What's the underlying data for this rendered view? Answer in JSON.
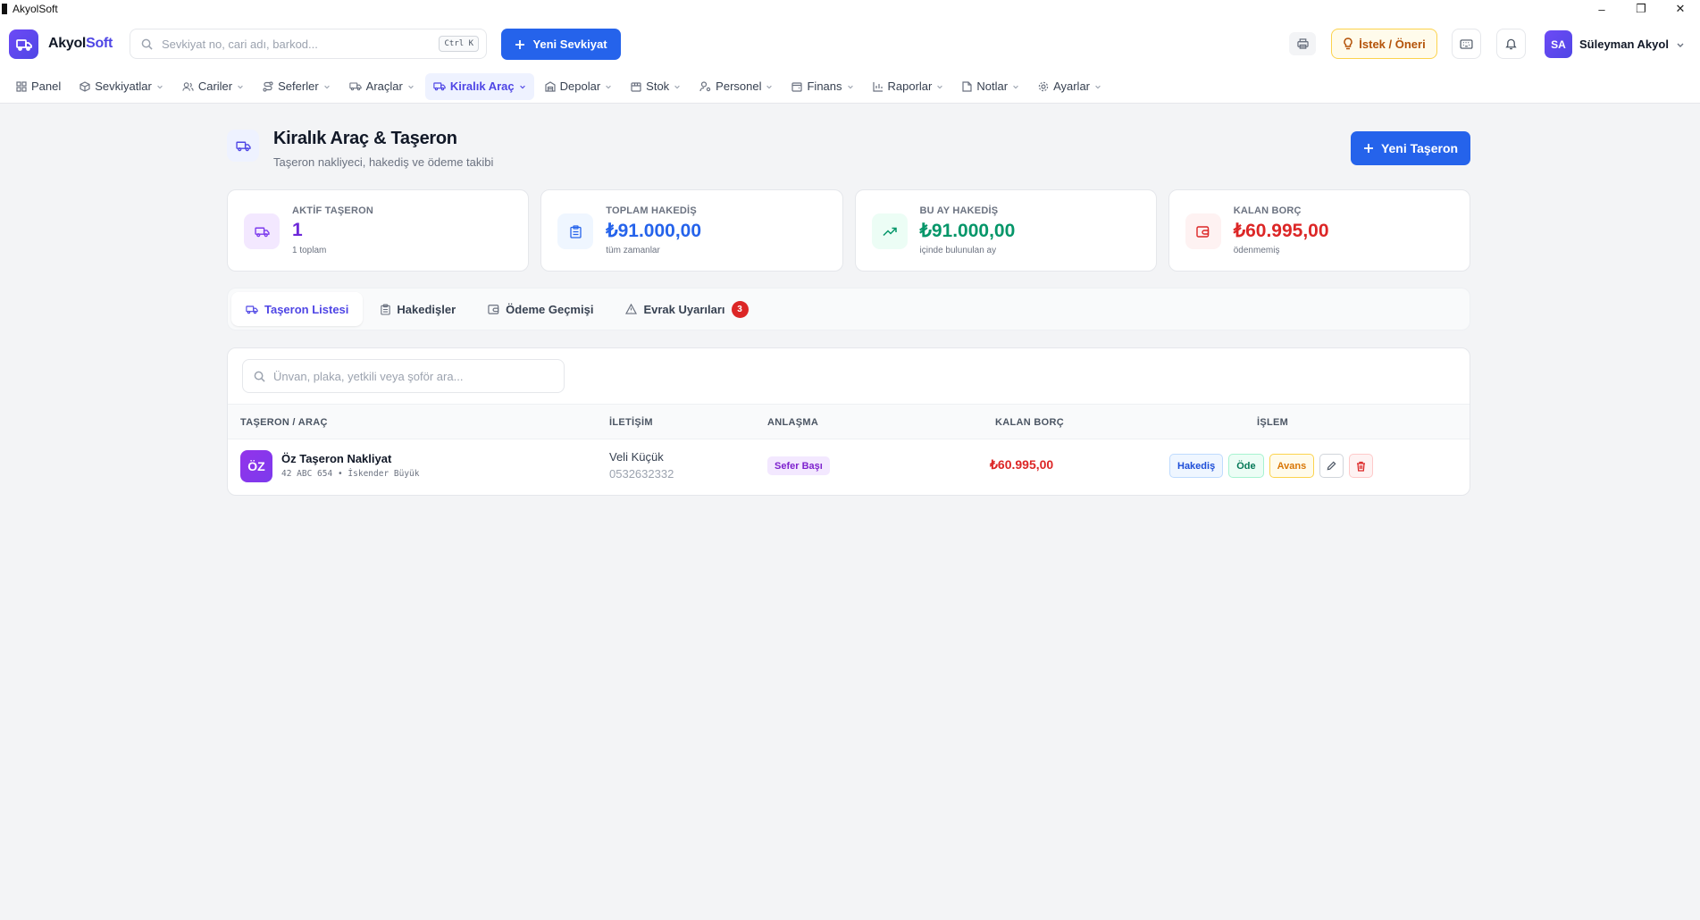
{
  "window": {
    "title": "AkyolSoft",
    "controls": [
      "–",
      "❐",
      "✕"
    ]
  },
  "header": {
    "logo_main": "Akyol",
    "logo_accent": "Soft",
    "search_placeholder": "Sevkiyat no, cari adı, barkod...",
    "search_shortcut": "Ctrl K",
    "new_shipment_label": "Yeni Sevkiyat",
    "suggestion_label": "İstek / Öneri",
    "user_initials": "SA",
    "user_name": "Süleyman Akyol"
  },
  "nav": {
    "items": [
      {
        "label": "Panel",
        "icon": "grid-icon"
      },
      {
        "label": "Sevkiyatlar",
        "icon": "box-icon"
      },
      {
        "label": "Cariler",
        "icon": "users-icon"
      },
      {
        "label": "Seferler",
        "icon": "route-icon"
      },
      {
        "label": "Araçlar",
        "icon": "truck-icon"
      },
      {
        "label": "Kiralık Araç",
        "icon": "truck-icon",
        "active": true
      },
      {
        "label": "Depolar",
        "icon": "warehouse-icon"
      },
      {
        "label": "Stok",
        "icon": "archive-icon"
      },
      {
        "label": "Personel",
        "icon": "user-cog-icon"
      },
      {
        "label": "Finans",
        "icon": "wallet-icon"
      },
      {
        "label": "Raporlar",
        "icon": "bar-chart-icon"
      },
      {
        "label": "Notlar",
        "icon": "note-icon"
      },
      {
        "label": "Ayarlar",
        "icon": "gear-icon"
      }
    ]
  },
  "page": {
    "title": "Kiralık Araç & Taşeron",
    "subtitle": "Taşeron nakliyeci, hakediş ve ödeme takibi",
    "new_button": "Yeni Taşeron"
  },
  "stats": [
    {
      "label": "AKTİF TAŞERON",
      "value": "1",
      "note": "1 toplam",
      "color": "#6d28d9",
      "icon": "truck-icon"
    },
    {
      "label": "TOPLAM HAKEDİŞ",
      "value": "₺91.000,00",
      "note": "tüm zamanlar",
      "color": "#2563eb",
      "icon": "clipboard-icon"
    },
    {
      "label": "BU AY HAKEDİŞ",
      "value": "₺91.000,00",
      "note": "içinde bulunulan ay",
      "color": "#059669",
      "icon": "trending-up-icon"
    },
    {
      "label": "KALAN BORÇ",
      "value": "₺60.995,00",
      "note": "ödenmemiş",
      "color": "#dc2626",
      "icon": "wallet-icon"
    }
  ],
  "tabs": [
    {
      "label": "Taşeron Listesi",
      "active": true,
      "icon": "truck-icon"
    },
    {
      "label": "Hakedişler",
      "icon": "clipboard-icon"
    },
    {
      "label": "Ödeme Geçmişi",
      "icon": "wallet-icon"
    },
    {
      "label": "Evrak Uyarıları",
      "badge": "3",
      "icon": "warning-icon"
    }
  ],
  "table": {
    "search_placeholder": "Ünvan, plaka, yetkili veya şoför ara...",
    "columns": [
      "TAŞERON / ARAÇ",
      "İLETİŞİM",
      "ANLAŞMA",
      "KALAN BORÇ",
      "İŞLEM"
    ],
    "rows": [
      {
        "initials": "ÖZ",
        "name": "Öz Taşeron Nakliyat",
        "plate": "42 ABC 654",
        "separator": "•",
        "driver": "İskender Büyük",
        "contact": "Veli Küçük",
        "phone": "0532632332",
        "agreement": "Sefer Başı",
        "debt": "₺60.995,00",
        "actions": {
          "hakedis": "Hakediş",
          "ode": "Öde",
          "avans": "Avans"
        }
      }
    ]
  }
}
